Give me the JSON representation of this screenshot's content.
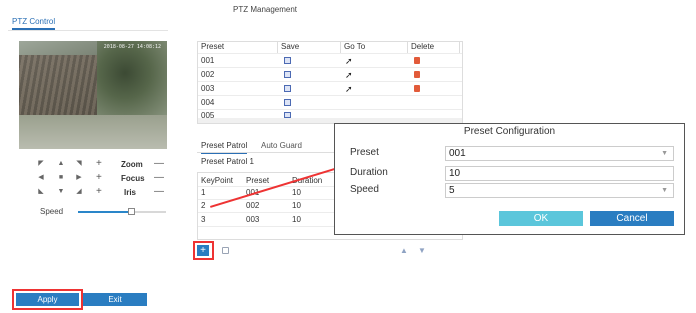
{
  "header": {
    "title": "PTZ Management"
  },
  "tabs": {
    "ptz_control": "PTZ Control"
  },
  "video": {
    "osd_text": "2018-08-27 14:08:12"
  },
  "controls": {
    "zoom_label": "Zoom",
    "focus_label": "Focus",
    "iris_label": "Iris",
    "plus_glyph": "+",
    "minus_glyph": "—",
    "speed_label": "Speed",
    "speed_level": 0.6
  },
  "buttons": {
    "apply": "Apply",
    "exit": "Exit"
  },
  "preset_table": {
    "columns": [
      "Preset",
      "Save",
      "Go To",
      "Delete"
    ],
    "rows": [
      {
        "preset": "001"
      },
      {
        "preset": "002"
      },
      {
        "preset": "003"
      },
      {
        "preset": "004"
      },
      {
        "preset": "005"
      }
    ]
  },
  "subtabs": {
    "preset_patrol": "Preset Patrol",
    "auto_guard": "Auto Guard"
  },
  "patrol": {
    "name": "Preset Patrol 1",
    "columns": [
      "KeyPoint",
      "Preset",
      "Duration"
    ],
    "rows": [
      {
        "keypoint": "1",
        "preset": "001",
        "duration": "10"
      },
      {
        "keypoint": "2",
        "preset": "002",
        "duration": "10"
      },
      {
        "keypoint": "3",
        "preset": "003",
        "duration": "10"
      }
    ],
    "add_glyph": "+"
  },
  "dialog": {
    "title": "Preset Configuration",
    "preset_label": "Preset",
    "preset_value": "001",
    "duration_label": "Duration",
    "duration_value": "10",
    "speed_label": "Speed",
    "speed_value": "5",
    "ok": "OK",
    "cancel": "Cancel"
  },
  "colors": {
    "accent": "#2a7dc1",
    "ok": "#5bc6db",
    "highlight": "#e33333"
  }
}
